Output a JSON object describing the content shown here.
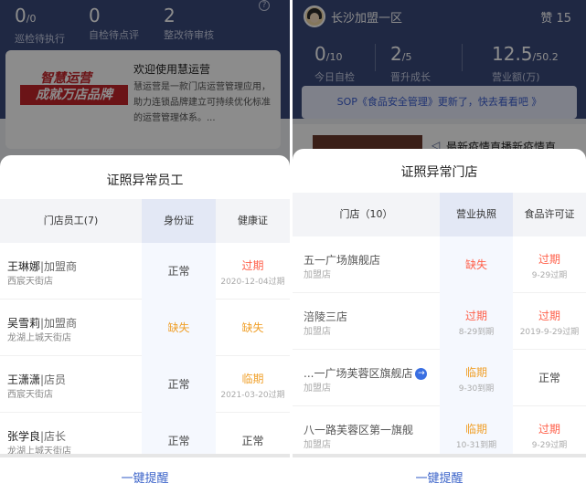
{
  "left": {
    "header": {
      "stats": [
        {
          "num": "0",
          "unit": "/0",
          "label": "巡检待执行"
        },
        {
          "num": "0",
          "unit": "",
          "label": "自检待点评"
        },
        {
          "num": "2",
          "unit": "",
          "label": "整改待审核"
        }
      ],
      "help": "?"
    },
    "welcome": {
      "logo_line1": "智慧运营",
      "logo_line2": "成就万店品牌",
      "title": "欢迎使用慧运营",
      "desc": "慧运营是一款门店运营管理应用，助力连锁品牌建立可持续优化标准的运营管理体系。..."
    },
    "sheet": {
      "title": "证照异常员工",
      "columns": [
        "门店员工(7)",
        "身份证",
        "健康证"
      ],
      "rows": [
        {
          "name": "王琳娜",
          "role": "|加盟商",
          "store": "西宸天街店",
          "c1": "正常",
          "c1d": "",
          "c2": "过期",
          "c2d": "2020-12-04过期"
        },
        {
          "name": "吴雪莉",
          "role": "|加盟商",
          "store": "龙湖上城天街店",
          "c1": "缺失",
          "c1d": "",
          "c2": "缺失",
          "c2d": ""
        },
        {
          "name": "王潇潇",
          "role": "|店员",
          "store": "西宸天街店",
          "c1": "正常",
          "c1d": "",
          "c2": "临期",
          "c2d": "2021-03-20过期"
        },
        {
          "name": "张学良",
          "role": "|店长",
          "store": "龙湖上城天街店",
          "c1": "正常",
          "c1d": "",
          "c2": "正常",
          "c2d": ""
        }
      ],
      "action": "一键提醒"
    }
  },
  "right": {
    "header": {
      "store": "长沙加盟一区",
      "praise": "赞 15",
      "stats": [
        {
          "num": "0",
          "unit": "/10",
          "label": "今日自检"
        },
        {
          "num": "2",
          "unit": "/5",
          "label": "晋升成长"
        },
        {
          "num": "12.5",
          "unit": "/50.2",
          "label": "营业额(万)"
        }
      ],
      "notice": "SOP《食品安全管理》更新了，快去看看吧 》",
      "live": "最新疫情直播新疫情直"
    },
    "sheet": {
      "title": "证照异常门店",
      "columns": [
        "门店（10）",
        "营业执照",
        "食品许可证"
      ],
      "rows": [
        {
          "name": "五一广场旗舰店",
          "type": "加盟店",
          "c1": "缺失",
          "c1d": "",
          "c2": "过期",
          "c2d": "9-29过期",
          "link": false
        },
        {
          "name": "涪陵三店",
          "type": "加盟店",
          "c1": "过期",
          "c1d": "8-29到期",
          "c2": "过期",
          "c2d": "2019-9-29过期",
          "link": false
        },
        {
          "name": "...一广场芙蓉区旗舰店",
          "type": "加盟店",
          "c1": "临期",
          "c1d": "9-30到期",
          "c2": "正常",
          "c2d": "",
          "link": true
        },
        {
          "name": "八一路芙蓉区第一旗舰",
          "type": "加盟店",
          "c1": "临期",
          "c1d": "10-31到期",
          "c2": "过期",
          "c2d": "9-29过期",
          "link": false
        }
      ],
      "link_icon": "→",
      "action": "一键提醒"
    }
  },
  "colors": {
    "header_bg": "#3a4a7a",
    "accent_blue": "#3b63c9",
    "status_red": "#ff5f49",
    "status_orange": "#f0a02a"
  }
}
